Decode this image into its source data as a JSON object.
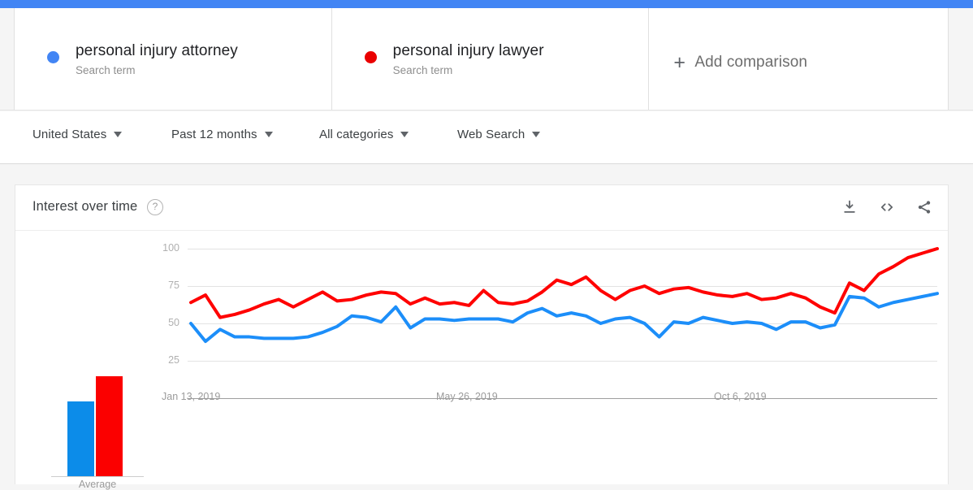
{
  "terms": [
    {
      "label": "personal injury attorney",
      "sublabel": "Search term",
      "color": "#4285f4"
    },
    {
      "label": "personal injury lawyer",
      "sublabel": "Search term",
      "color": "#ea0000"
    }
  ],
  "add_comparison": {
    "label": "Add comparison",
    "icon": "plus-icon"
  },
  "filters": [
    {
      "label": "United States"
    },
    {
      "label": "Past 12 months"
    },
    {
      "label": "All categories"
    },
    {
      "label": "Web Search"
    }
  ],
  "card": {
    "title": "Interest over time",
    "help_icon": "?",
    "actions": [
      {
        "name": "download-icon"
      },
      {
        "name": "embed-code-icon"
      },
      {
        "name": "share-icon"
      }
    ]
  },
  "average": {
    "label": "Average",
    "bars": [
      {
        "series": "personal injury attorney",
        "value": 50,
        "color": "#0c8ce9"
      },
      {
        "series": "personal injury lawyer",
        "value": 67,
        "color": "#fb0000"
      }
    ]
  },
  "chart_data": {
    "type": "line",
    "title": "Interest over time",
    "xlabel": "",
    "ylabel": "",
    "ylim": [
      0,
      100
    ],
    "yticks": [
      25,
      50,
      75,
      100
    ],
    "grid": true,
    "legend_position": "top",
    "xtick_labels": [
      "Jan 13, 2019",
      "May 26, 2019",
      "Oct 6, 2019"
    ],
    "xtick_indices": [
      0,
      19,
      38
    ],
    "series": [
      {
        "name": "personal injury attorney",
        "color": "#1c8ef9",
        "values": [
          50,
          38,
          46,
          41,
          41,
          40,
          40,
          40,
          41,
          44,
          48,
          55,
          54,
          51,
          61,
          47,
          53,
          53,
          52,
          53,
          53,
          53,
          51,
          57,
          60,
          55,
          57,
          55,
          50,
          53,
          54,
          50,
          41,
          51,
          50,
          54,
          52,
          50,
          51,
          50,
          46,
          51,
          51,
          47,
          49,
          68,
          67,
          61,
          64,
          66,
          68,
          70
        ]
      },
      {
        "name": "personal injury lawyer",
        "color": "#ff0000",
        "values": [
          64,
          69,
          54,
          56,
          59,
          63,
          66,
          61,
          66,
          71,
          65,
          66,
          69,
          71,
          70,
          63,
          67,
          63,
          64,
          62,
          72,
          64,
          63,
          65,
          71,
          79,
          76,
          81,
          72,
          66,
          72,
          75,
          70,
          73,
          74,
          71,
          69,
          68,
          70,
          66,
          67,
          70,
          67,
          61,
          57,
          77,
          72,
          83,
          88,
          94,
          97,
          100
        ]
      }
    ]
  }
}
